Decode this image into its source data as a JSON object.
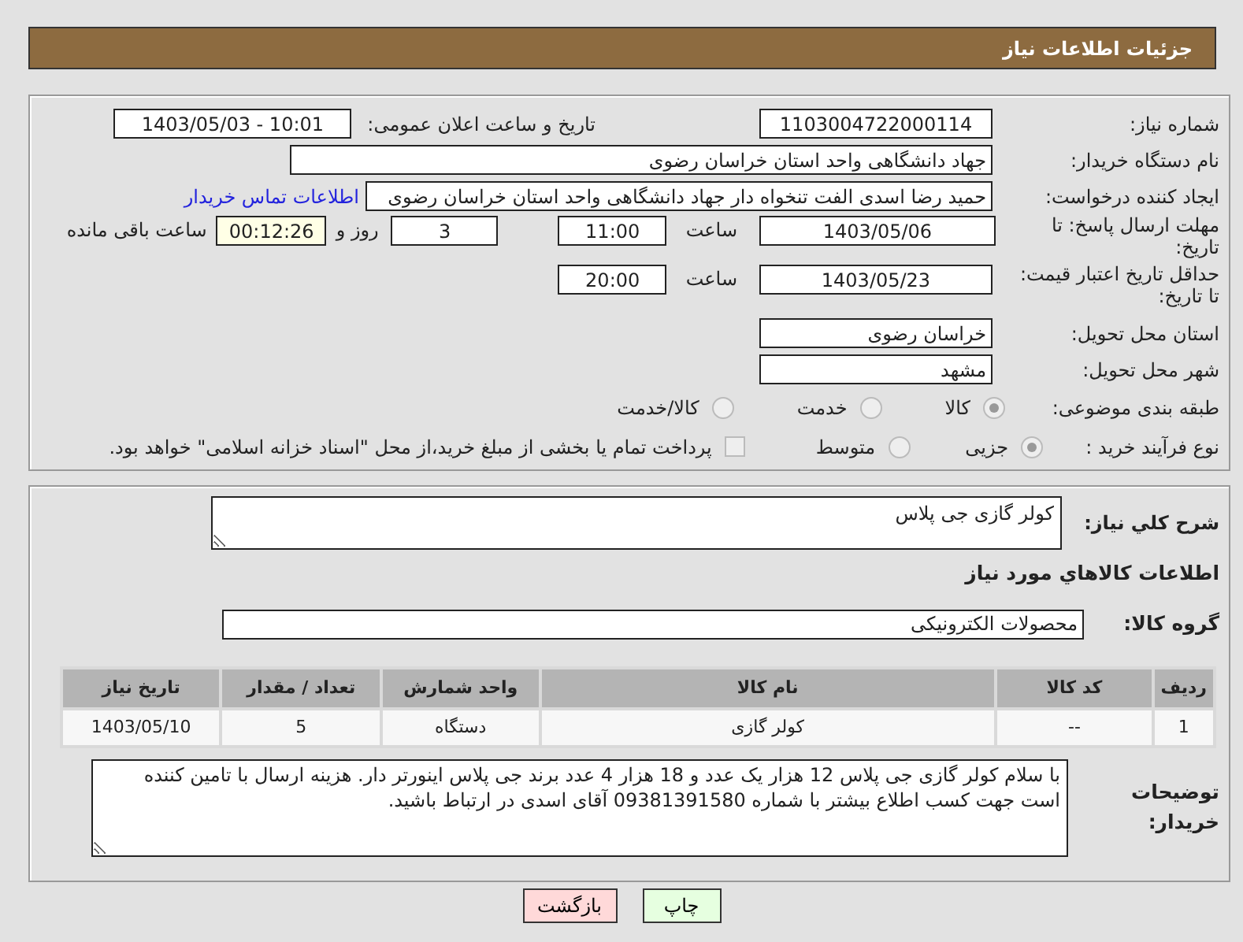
{
  "header": {
    "title": "جزئیات اطلاعات نیاز"
  },
  "need_number": {
    "label": "شماره نیاز:",
    "value": "1103004722000114"
  },
  "announce": {
    "label": "تاریخ و ساعت اعلان عمومی:",
    "value": "1403/05/03 - 10:01"
  },
  "buyer_org": {
    "label": "نام دستگاه خریدار:",
    "value": "جهاد دانشگاهی واحد استان خراسان رضوی"
  },
  "requester": {
    "label": "ایجاد کننده درخواست:",
    "value": "حمید رضا اسدی الفت تنخواه دار جهاد دانشگاهی واحد استان خراسان رضوی",
    "link": "اطلاعات تماس خریدار"
  },
  "deadline": {
    "label": "مهلت ارسال پاسخ: تا تاریخ:",
    "date": "1403/05/06",
    "time_label": "ساعت",
    "time": "11:00",
    "days": "3",
    "days_label": "روز و",
    "remaining": "00:12:26",
    "remaining_label": "ساعت باقی مانده"
  },
  "validity": {
    "label": "حداقل تاریخ اعتبار قیمت: تا تاریخ:",
    "date": "1403/05/23",
    "time_label": "ساعت",
    "time": "20:00"
  },
  "province": {
    "label": "استان محل تحویل:",
    "value": "خراسان رضوی"
  },
  "city": {
    "label": "شهر محل تحویل:",
    "value": "مشهد"
  },
  "category": {
    "label": "طبقه بندی موضوعی:",
    "options": [
      {
        "label": "کالا",
        "selected": true
      },
      {
        "label": "خدمت",
        "selected": false
      },
      {
        "label": "کالا/خدمت",
        "selected": false
      }
    ]
  },
  "process": {
    "label": "نوع فرآیند خرید :",
    "options": [
      {
        "label": "جزیی",
        "selected": true
      },
      {
        "label": "متوسط",
        "selected": false
      }
    ],
    "payment": {
      "label": "پرداخت تمام یا بخشی از مبلغ خرید،از محل \"اسناد خزانه اسلامی\" خواهد بود.",
      "checked": false
    }
  },
  "description": {
    "label": "شرح کلي نياز:",
    "value": "کولر گازی جی پلاس"
  },
  "items_title": "اطلاعات کالاهاي مورد نياز",
  "goods_group": {
    "label": "گروه کالا:",
    "value": "محصولات الکترونیکی"
  },
  "table": {
    "columns": [
      "ردیف",
      "کد کالا",
      "نام کالا",
      "واحد شمارش",
      "تعداد / مقدار",
      "تاریخ نیاز"
    ],
    "rows": [
      [
        "1",
        "--",
        "کولر گازی",
        "دستگاه",
        "5",
        "1403/05/10"
      ]
    ]
  },
  "buyer_notes": {
    "label": "توضیحات خریدار:",
    "value": "با سلام کولر گازی جی پلاس 12 هزار یک عدد و 18 هزار 4 عدد برند جی پلاس اینورتر دار. هزینه ارسال با تامین کننده است جهت کسب اطلاع بیشتر با شماره 09381391580 آقای اسدی در ارتباط باشید."
  },
  "buttons": [
    {
      "kind": "print",
      "label": "چاپ"
    },
    {
      "kind": "back",
      "label": "بازگشت"
    }
  ]
}
